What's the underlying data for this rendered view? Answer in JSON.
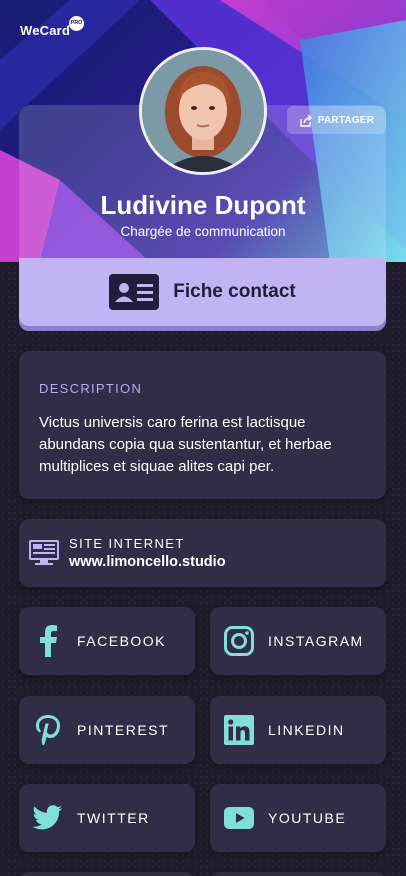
{
  "app": {
    "brand": "WeCard",
    "badge": "PRO"
  },
  "header": {
    "share_label": "PARTAGER",
    "name": "Ludivine Dupont",
    "role": "Chargée de communication"
  },
  "contact_button": {
    "label": "Fiche contact"
  },
  "description": {
    "title": "DESCRIPTION",
    "text": "Victus universis caro ferina est lactisque abundans copia qua sustentantur, et herbae multiplices et siquae alites capi per."
  },
  "website": {
    "title": "SITE INTERNET",
    "url": "www.limoncello.studio"
  },
  "socials": [
    {
      "label": "FACEBOOK",
      "icon": "facebook-icon"
    },
    {
      "label": "INSTAGRAM",
      "icon": "instagram-icon"
    },
    {
      "label": "PINTEREST",
      "icon": "pinterest-icon"
    },
    {
      "label": "LINKEDIN",
      "icon": "linkedin-icon"
    },
    {
      "label": "TWITTER",
      "icon": "twitter-icon"
    },
    {
      "label": "YOUTUBE",
      "icon": "youtube-icon"
    }
  ],
  "colors": {
    "accent": "#c2b4f4",
    "icon": "#7ee0d6",
    "card": "#322d46",
    "background": "#201c2c"
  }
}
